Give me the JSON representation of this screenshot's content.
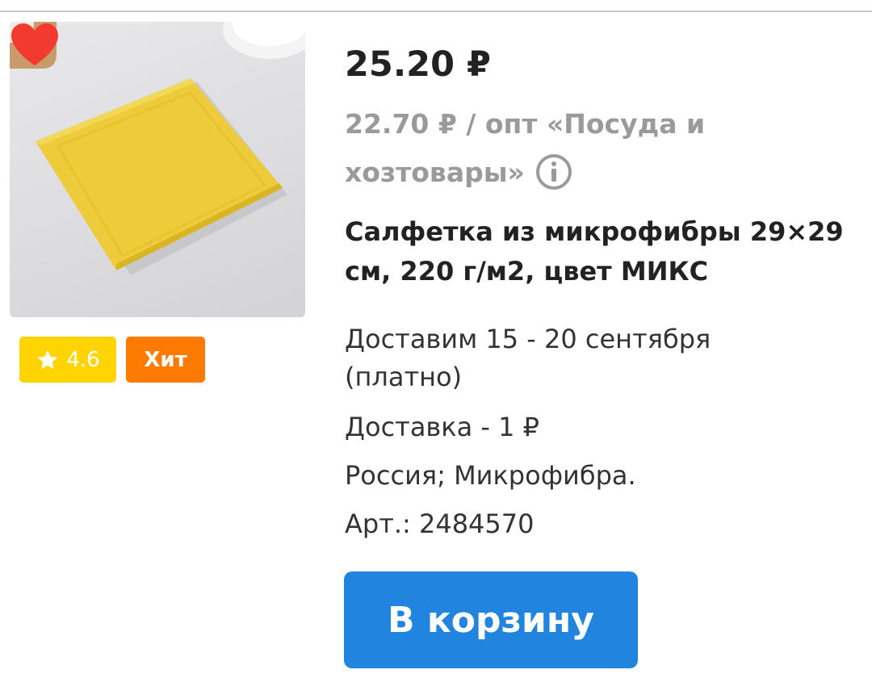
{
  "product": {
    "price": "25.20 ₽",
    "wholesale": {
      "text": "22.70 ₽ / опт «Посуда и хозтовары»",
      "info_icon": "info-icon"
    },
    "title": "Салфетка из микрофибры 29×29 см, 220 г/м2, цвет МИКС",
    "delivery_date": "Доставим 15 - 20 сентября (платно)",
    "delivery_cost": "Доставка - 1 ₽",
    "origin": "Россия; Микрофибра.",
    "article": "Арт.: 2484570",
    "favorite_icon": "heart-icon",
    "favorite_color": "#f23a30"
  },
  "badges": {
    "rating": {
      "icon": "star-icon",
      "value": "4.6",
      "color": "#ffd400"
    },
    "hit": {
      "label": "Хит",
      "color": "#ff7a00"
    }
  },
  "actions": {
    "add_to_cart_label": "В корзину",
    "button_color": "#2185e0"
  }
}
